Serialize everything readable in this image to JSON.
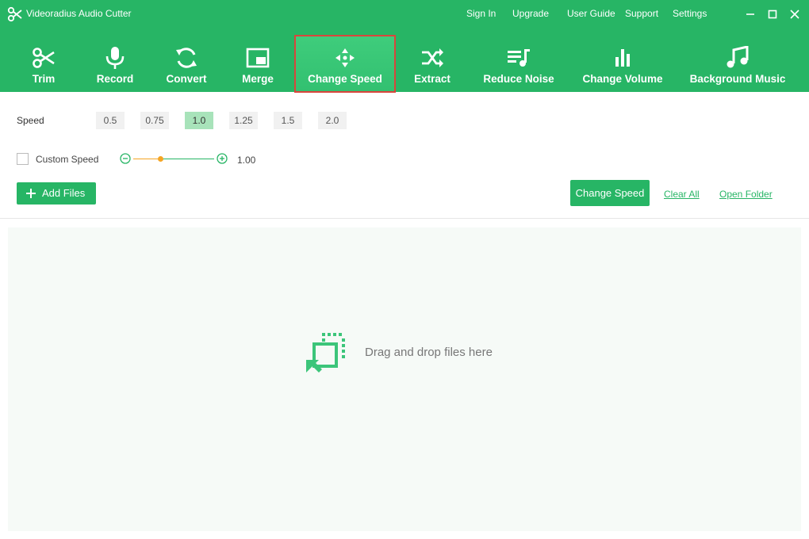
{
  "window": {
    "title": "Videoradius Audio Cutter",
    "links": [
      "Sign In",
      "Upgrade",
      "User Guide",
      "Support",
      "Settings"
    ]
  },
  "toolbar": {
    "items": [
      {
        "label": "Trim",
        "icon": "scissors-icon"
      },
      {
        "label": "Record",
        "icon": "microphone-icon"
      },
      {
        "label": "Convert",
        "icon": "refresh-icon"
      },
      {
        "label": "Merge",
        "icon": "merge-icon"
      },
      {
        "label": "Change Speed",
        "icon": "speed-icon"
      },
      {
        "label": "Extract",
        "icon": "shuffle-icon"
      },
      {
        "label": "Reduce Noise",
        "icon": "playlist-icon"
      },
      {
        "label": "Change Volume",
        "icon": "bars-icon"
      },
      {
        "label": "Background Music",
        "icon": "music-note-icon"
      }
    ],
    "active": "Change Speed"
  },
  "speed": {
    "label": "Speed",
    "options": [
      "0.5",
      "0.75",
      "1.0",
      "1.25",
      "1.5",
      "2.0"
    ],
    "selected": "1.0"
  },
  "custom_speed": {
    "label": "Custom Speed",
    "checked": false,
    "value": "1.00",
    "slider_level": 0.33
  },
  "actions": {
    "add_files": "Add Files",
    "change_speed": "Change Speed",
    "clear_all": "Clear All",
    "open_folder": "Open Folder"
  },
  "drop_zone": {
    "text": "Drag and drop files here"
  },
  "colors": {
    "accent": "#27b565",
    "active_frame": "#d9453c",
    "slider": "#f5a524",
    "selected_option": "#a8e3ba"
  }
}
